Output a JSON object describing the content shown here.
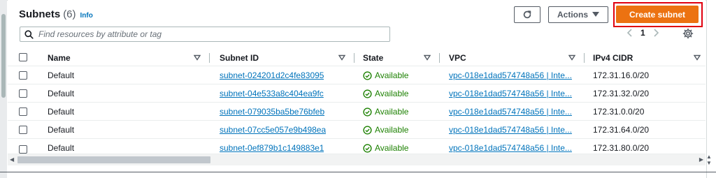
{
  "header": {
    "title": "Subnets",
    "count": "(6)",
    "info": "Info",
    "refresh_icon": "refresh-icon",
    "actions_label": "Actions",
    "create_label": "Create subnet"
  },
  "search": {
    "placeholder": "Find resources by attribute or tag"
  },
  "pagination": {
    "current_page": "1"
  },
  "columns": [
    "Name",
    "Subnet ID",
    "State",
    "VPC",
    "IPv4 CIDR"
  ],
  "rows": [
    {
      "name": "Default",
      "subnet_id": "subnet-024201d2c4fe83095",
      "state": "Available",
      "vpc": "vpc-018e1dad574748a56 | Inte...",
      "cidr": "172.31.16.0/20"
    },
    {
      "name": "Default",
      "subnet_id": "subnet-04e533a8c404ea9fc",
      "state": "Available",
      "vpc": "vpc-018e1dad574748a56 | Inte...",
      "cidr": "172.31.32.0/20"
    },
    {
      "name": "Default",
      "subnet_id": "subnet-079035ba5be76bfeb",
      "state": "Available",
      "vpc": "vpc-018e1dad574748a56 | Inte...",
      "cidr": "172.31.0.0/20"
    },
    {
      "name": "Default",
      "subnet_id": "subnet-07cc5e057e9b498ea",
      "state": "Available",
      "vpc": "vpc-018e1dad574748a56 | Inte...",
      "cidr": "172.31.64.0/20"
    },
    {
      "name": "Default",
      "subnet_id": "subnet-0ef879b1c149883e1",
      "state": "Available",
      "vpc": "vpc-018e1dad574748a56 | Inte...",
      "cidr": "172.31.80.0/20"
    }
  ],
  "colors": {
    "primary_button": "#ec7211",
    "link": "#0073bb",
    "available": "#1d8102",
    "highlight_box": "#e0000f"
  }
}
